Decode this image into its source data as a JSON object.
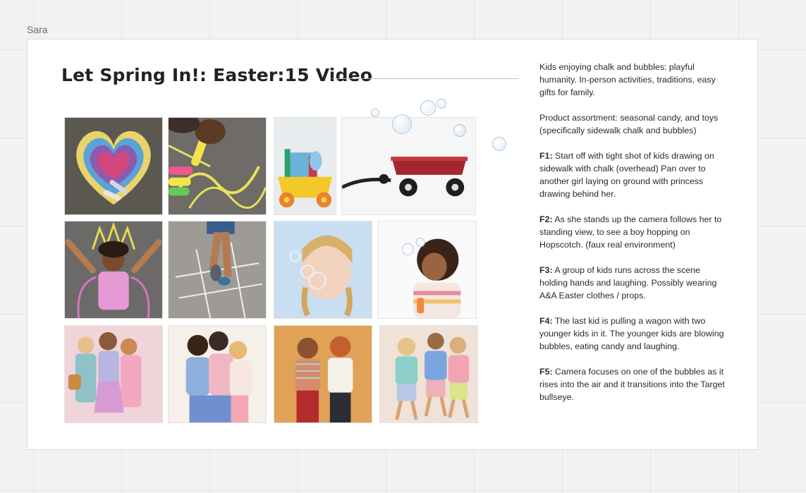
{
  "frame": {
    "label": "Sara"
  },
  "board": {
    "title": "Let Spring In!: Easter:15 Video"
  },
  "tiles": [
    {
      "name": "chalk-heart-photo"
    },
    {
      "name": "child-drawing-chalk-photo"
    },
    {
      "name": "easter-basket-photo"
    },
    {
      "name": "red-wagon-photo"
    },
    {
      "name": "girl-chalk-crown-photo"
    },
    {
      "name": "hopscotch-legs-photo"
    },
    {
      "name": "girl-blowing-bubbles-photo"
    },
    {
      "name": "child-with-bubbles-photo"
    },
    {
      "name": "girls-group-photo"
    },
    {
      "name": "kids-hugging-photo"
    },
    {
      "name": "boy-and-girl-photo"
    },
    {
      "name": "kids-running-photo"
    }
  ],
  "notes": {
    "intro": "Kids enjoying chalk and bubbles: playful humanity. In-person activities, traditions, easy gifts for family.",
    "assortment": "Product assortment: seasonal candy, and toys (specifically sidewalk chalk and bubbles)",
    "frames": [
      {
        "label": "F1:",
        "text": " Start off with tight shot of kids drawing on sidewalk with chalk (overhead) Pan over to another girl laying on ground with princess drawing behind her."
      },
      {
        "label": "F2:",
        "text": " As she stands up the camera follows her to standing view, to see a boy hopping on Hopscotch. (faux real environment)"
      },
      {
        "label": "F3:",
        "text": "  A group of kids runs across the scene holding hands and laughing. Possibly wearing A&A Easter clothes / props."
      },
      {
        "label": "F4:",
        "text": " The last kid is pulling a wagon with two younger kids in it. The younger kids are blowing bubbles, eating candy and laughing."
      },
      {
        "label": "F5:",
        "text": "  Camera focuses on one of the bubbles as it rises into the air and it transitions into the Target bullseye."
      }
    ]
  }
}
